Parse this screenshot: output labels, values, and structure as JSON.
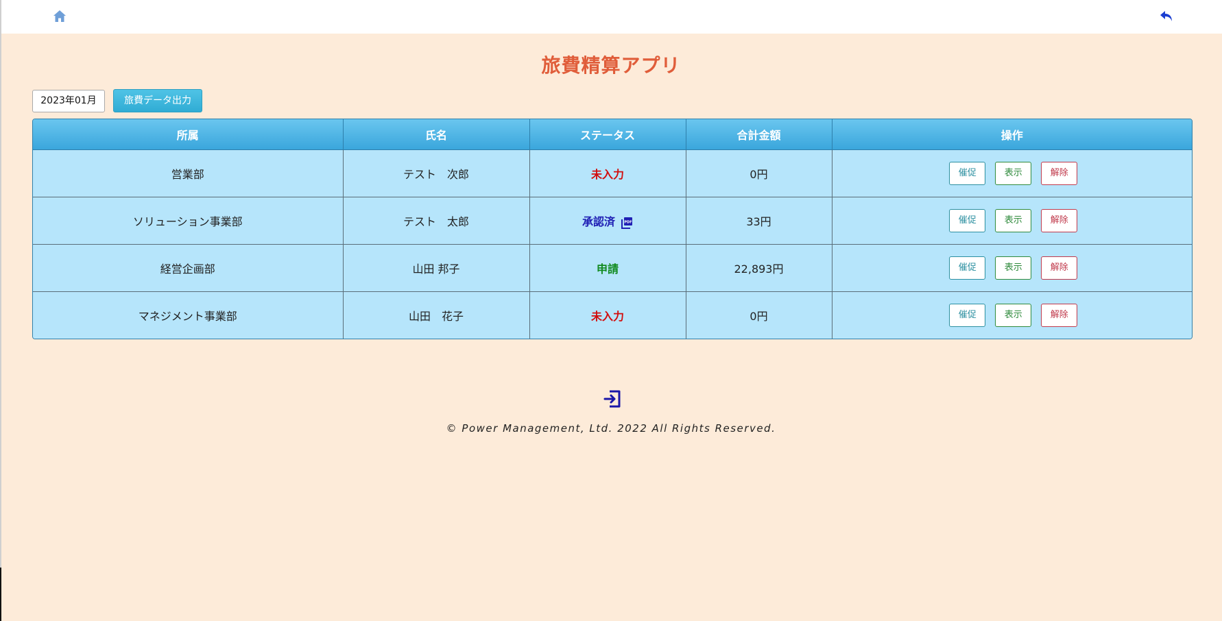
{
  "colors": {
    "background": "#fdebd9",
    "title": "#e05d3a",
    "header_bg": "#4db5e6",
    "row_bg": "#b6e5fb",
    "status_unentered": "#d20d0d",
    "status_approved": "#1f1fb4",
    "status_applied": "#118a1f"
  },
  "topbar": {
    "home_icon": "home-icon",
    "back_icon": "back-arrow-icon"
  },
  "title": "旅費精算アプリ",
  "controls": {
    "month_value": "2023年01月",
    "export_label": "旅費データ出力"
  },
  "table": {
    "headers": [
      "所属",
      "氏名",
      "ステータス",
      "合計金額",
      "操作"
    ],
    "rows": [
      {
        "department": "営業部",
        "name": "テスト　次郎",
        "status": "未入力",
        "status_type": "unentered",
        "total": "0円",
        "has_pdf": false
      },
      {
        "department": "ソリューション事業部",
        "name": "テスト　太郎",
        "status": "承認済",
        "status_type": "approved",
        "total": "33円",
        "has_pdf": true
      },
      {
        "department": "経営企画部",
        "name": "山田 邦子",
        "status": "申請",
        "status_type": "applied",
        "total": "22,893円",
        "has_pdf": false
      },
      {
        "department": "マネジメント事業部",
        "name": "山田　花子",
        "status": "未入力",
        "status_type": "unentered",
        "total": "0円",
        "has_pdf": false
      }
    ],
    "actions": {
      "remind": "催促",
      "show": "表示",
      "release": "解除"
    },
    "pdf_icon": "pdf-icon"
  },
  "logout_icon": "logout-icon",
  "footer": "© Power Management, Ltd. 2022 All Rights Reserved."
}
